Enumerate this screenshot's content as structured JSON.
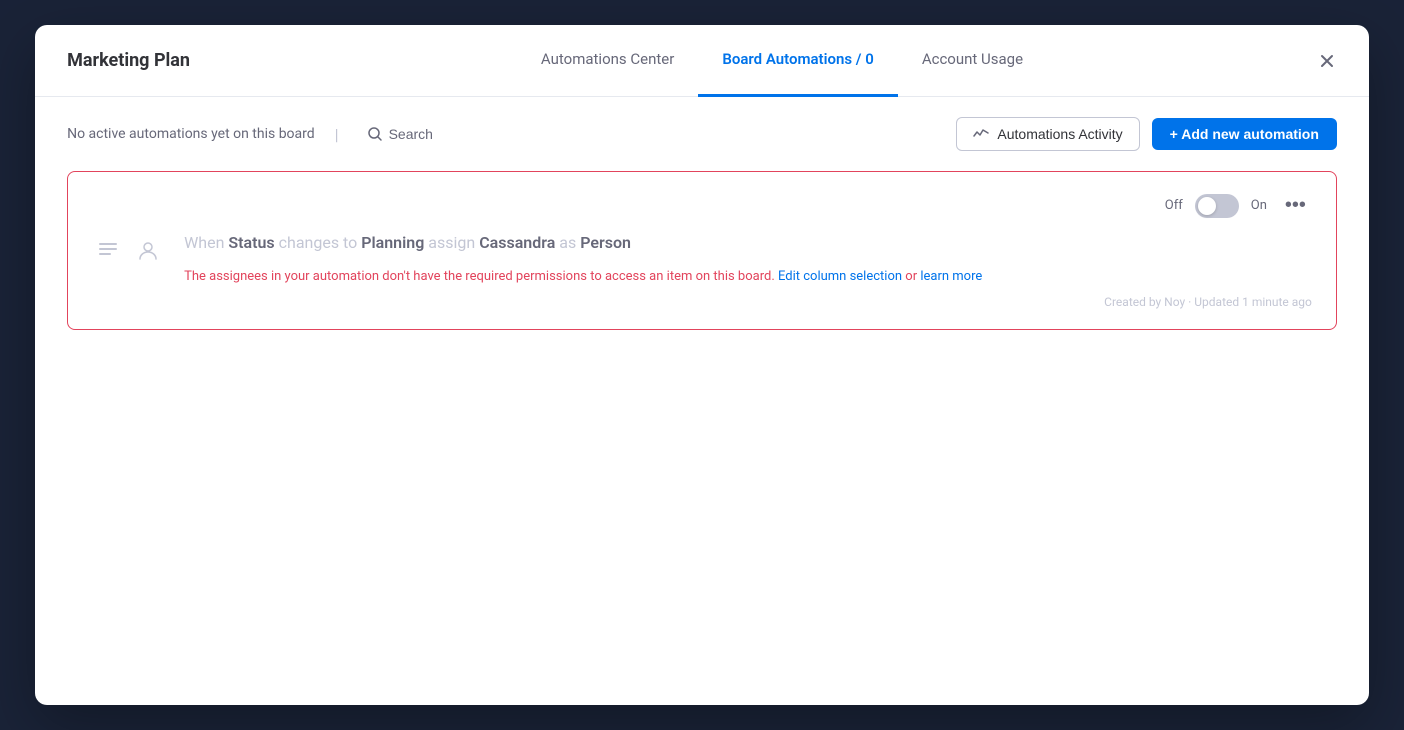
{
  "modal": {
    "title": "Marketing Plan",
    "close_label": "×"
  },
  "tabs": [
    {
      "id": "automations-center",
      "label": "Automations Center",
      "active": false
    },
    {
      "id": "board-automations",
      "label": "Board Automations / 0",
      "active": true
    },
    {
      "id": "account-usage",
      "label": "Account Usage",
      "active": false
    }
  ],
  "toolbar": {
    "no_automations_text": "No active automations yet on this board",
    "separator": "|",
    "search_label": "Search",
    "automations_activity_label": "Automations Activity",
    "add_automation_label": "+ Add new automation"
  },
  "automation_card": {
    "toggle_off_label": "Off",
    "toggle_on_label": "On",
    "rule_text_prefix": "When ",
    "status_keyword": "Status",
    "rule_text_middle": " changes to ",
    "planning_keyword": "Planning",
    "rule_text_assign": " assign ",
    "person_name": "Cassandra",
    "rule_text_as": " as ",
    "person_keyword": "Person",
    "warning_text": "The assignees in your automation don't have the required permissions to access an item on this board.",
    "edit_link": "Edit column selection",
    "or_text": " or ",
    "learn_more_link": "learn more",
    "meta_text": "Created by Noy · Updated 1 minute ago"
  },
  "colors": {
    "active_tab": "#0073ea",
    "add_btn_bg": "#0073ea",
    "card_border": "#e2445c",
    "warning_text": "#e2445c",
    "link_color": "#0073ea"
  }
}
